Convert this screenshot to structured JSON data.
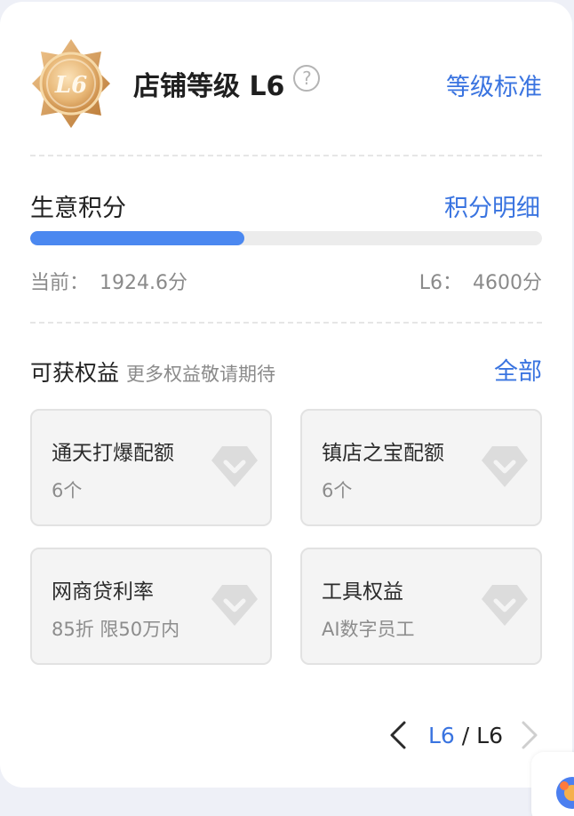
{
  "header": {
    "badge_text": "L6",
    "title": "店铺等级 L6",
    "help_symbol": "?",
    "level_standard_link": "等级标准"
  },
  "score": {
    "title": "生意积分",
    "detail_link": "积分明细",
    "progress_fraction": 0.418,
    "current_label": "当前：",
    "current_value": "1924.6分",
    "target_label": "L6：",
    "target_value": "4600分"
  },
  "benefits": {
    "title": "可获权益",
    "subtitle": "更多权益敬请期待",
    "all_link": "全部",
    "items": [
      {
        "name": "通天打爆配额",
        "value": "6个"
      },
      {
        "name": "镇店之宝配额",
        "value": "6个"
      },
      {
        "name": "网商贷利率",
        "value": "85折 限50万内"
      },
      {
        "name": "工具权益",
        "value": "AI数字员工"
      }
    ]
  },
  "pager": {
    "current": "L6",
    "separator": " / ",
    "total": "L6"
  },
  "colors": {
    "accent": "#3a74e0",
    "progress": "#4b88f0",
    "badge_gold": "#e0a865"
  }
}
